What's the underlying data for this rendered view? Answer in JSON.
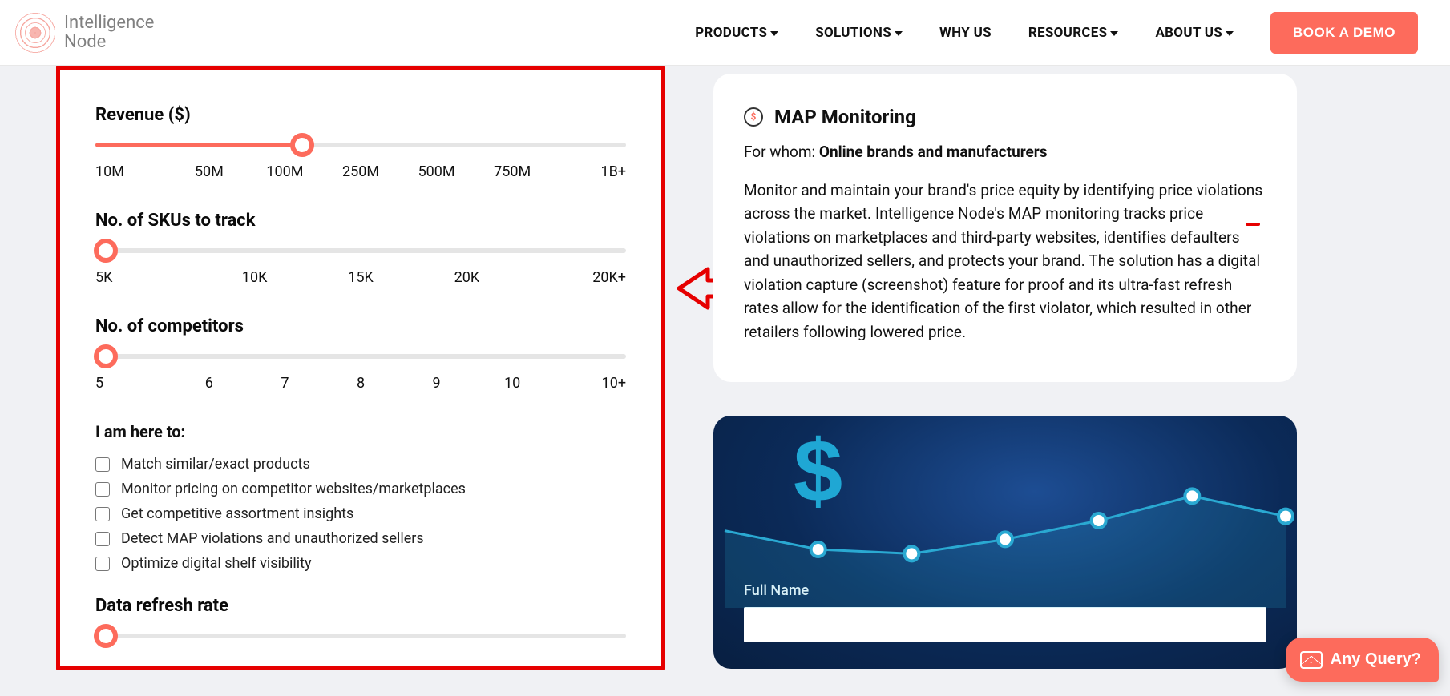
{
  "brand": {
    "line1": "Intelligence",
    "line2": "Node"
  },
  "nav": {
    "products": "PRODUCTS",
    "solutions": "SOLUTIONS",
    "why_us": "WHY US",
    "resources": "RESOURCES",
    "about_us": "ABOUT US",
    "demo": "BOOK A DEMO"
  },
  "sliders": {
    "revenue": {
      "label": "Revenue ($)",
      "ticks": [
        "10M",
        "50M",
        "100M",
        "250M",
        "500M",
        "750M",
        "1B+"
      ],
      "value_index": 2
    },
    "skus": {
      "label": "No. of SKUs to track",
      "ticks": [
        "5K",
        "10K",
        "15K",
        "20K",
        "20K+"
      ],
      "value_index": 0
    },
    "competitors": {
      "label": "No. of competitors",
      "ticks": [
        "5",
        "6",
        "7",
        "8",
        "9",
        "10",
        "10+"
      ],
      "value_index": 0
    },
    "refresh": {
      "label": "Data refresh rate"
    }
  },
  "checks": {
    "title": "I am here to:",
    "items": [
      "Match similar/exact products",
      "Monitor pricing on competitor websites/marketplaces",
      "Get competitive assortment insights",
      "Detect MAP violations and unauthorized sellers",
      "Optimize digital shelf visibility"
    ]
  },
  "info": {
    "title": "MAP Monitoring",
    "for_whom_label": "For whom: ",
    "for_whom_value": "Online brands and manufacturers",
    "body": "Monitor and maintain your brand's price equity by identifying price violations across the market. Intelligence Node's MAP monitoring tracks price violations on marketplaces and third-party websites, identifies defaulters and unauthorized sellers, and protects your brand. The solution has a digital violation capture (screenshot) feature for proof and its ultra-fast refresh rates allow for the identification of the first violator, which resulted in other retailers following lowered price."
  },
  "form": {
    "full_name_label": "Full Name"
  },
  "chat": {
    "label": "Any Query?"
  },
  "chart_data": {
    "type": "line",
    "title": "",
    "x": [
      0,
      1,
      2,
      3,
      4,
      5,
      6
    ],
    "values": [
      48,
      35,
      32,
      42,
      55,
      72,
      58
    ],
    "ylim": [
      0,
      100
    ],
    "xlabel": "",
    "ylabel": ""
  }
}
